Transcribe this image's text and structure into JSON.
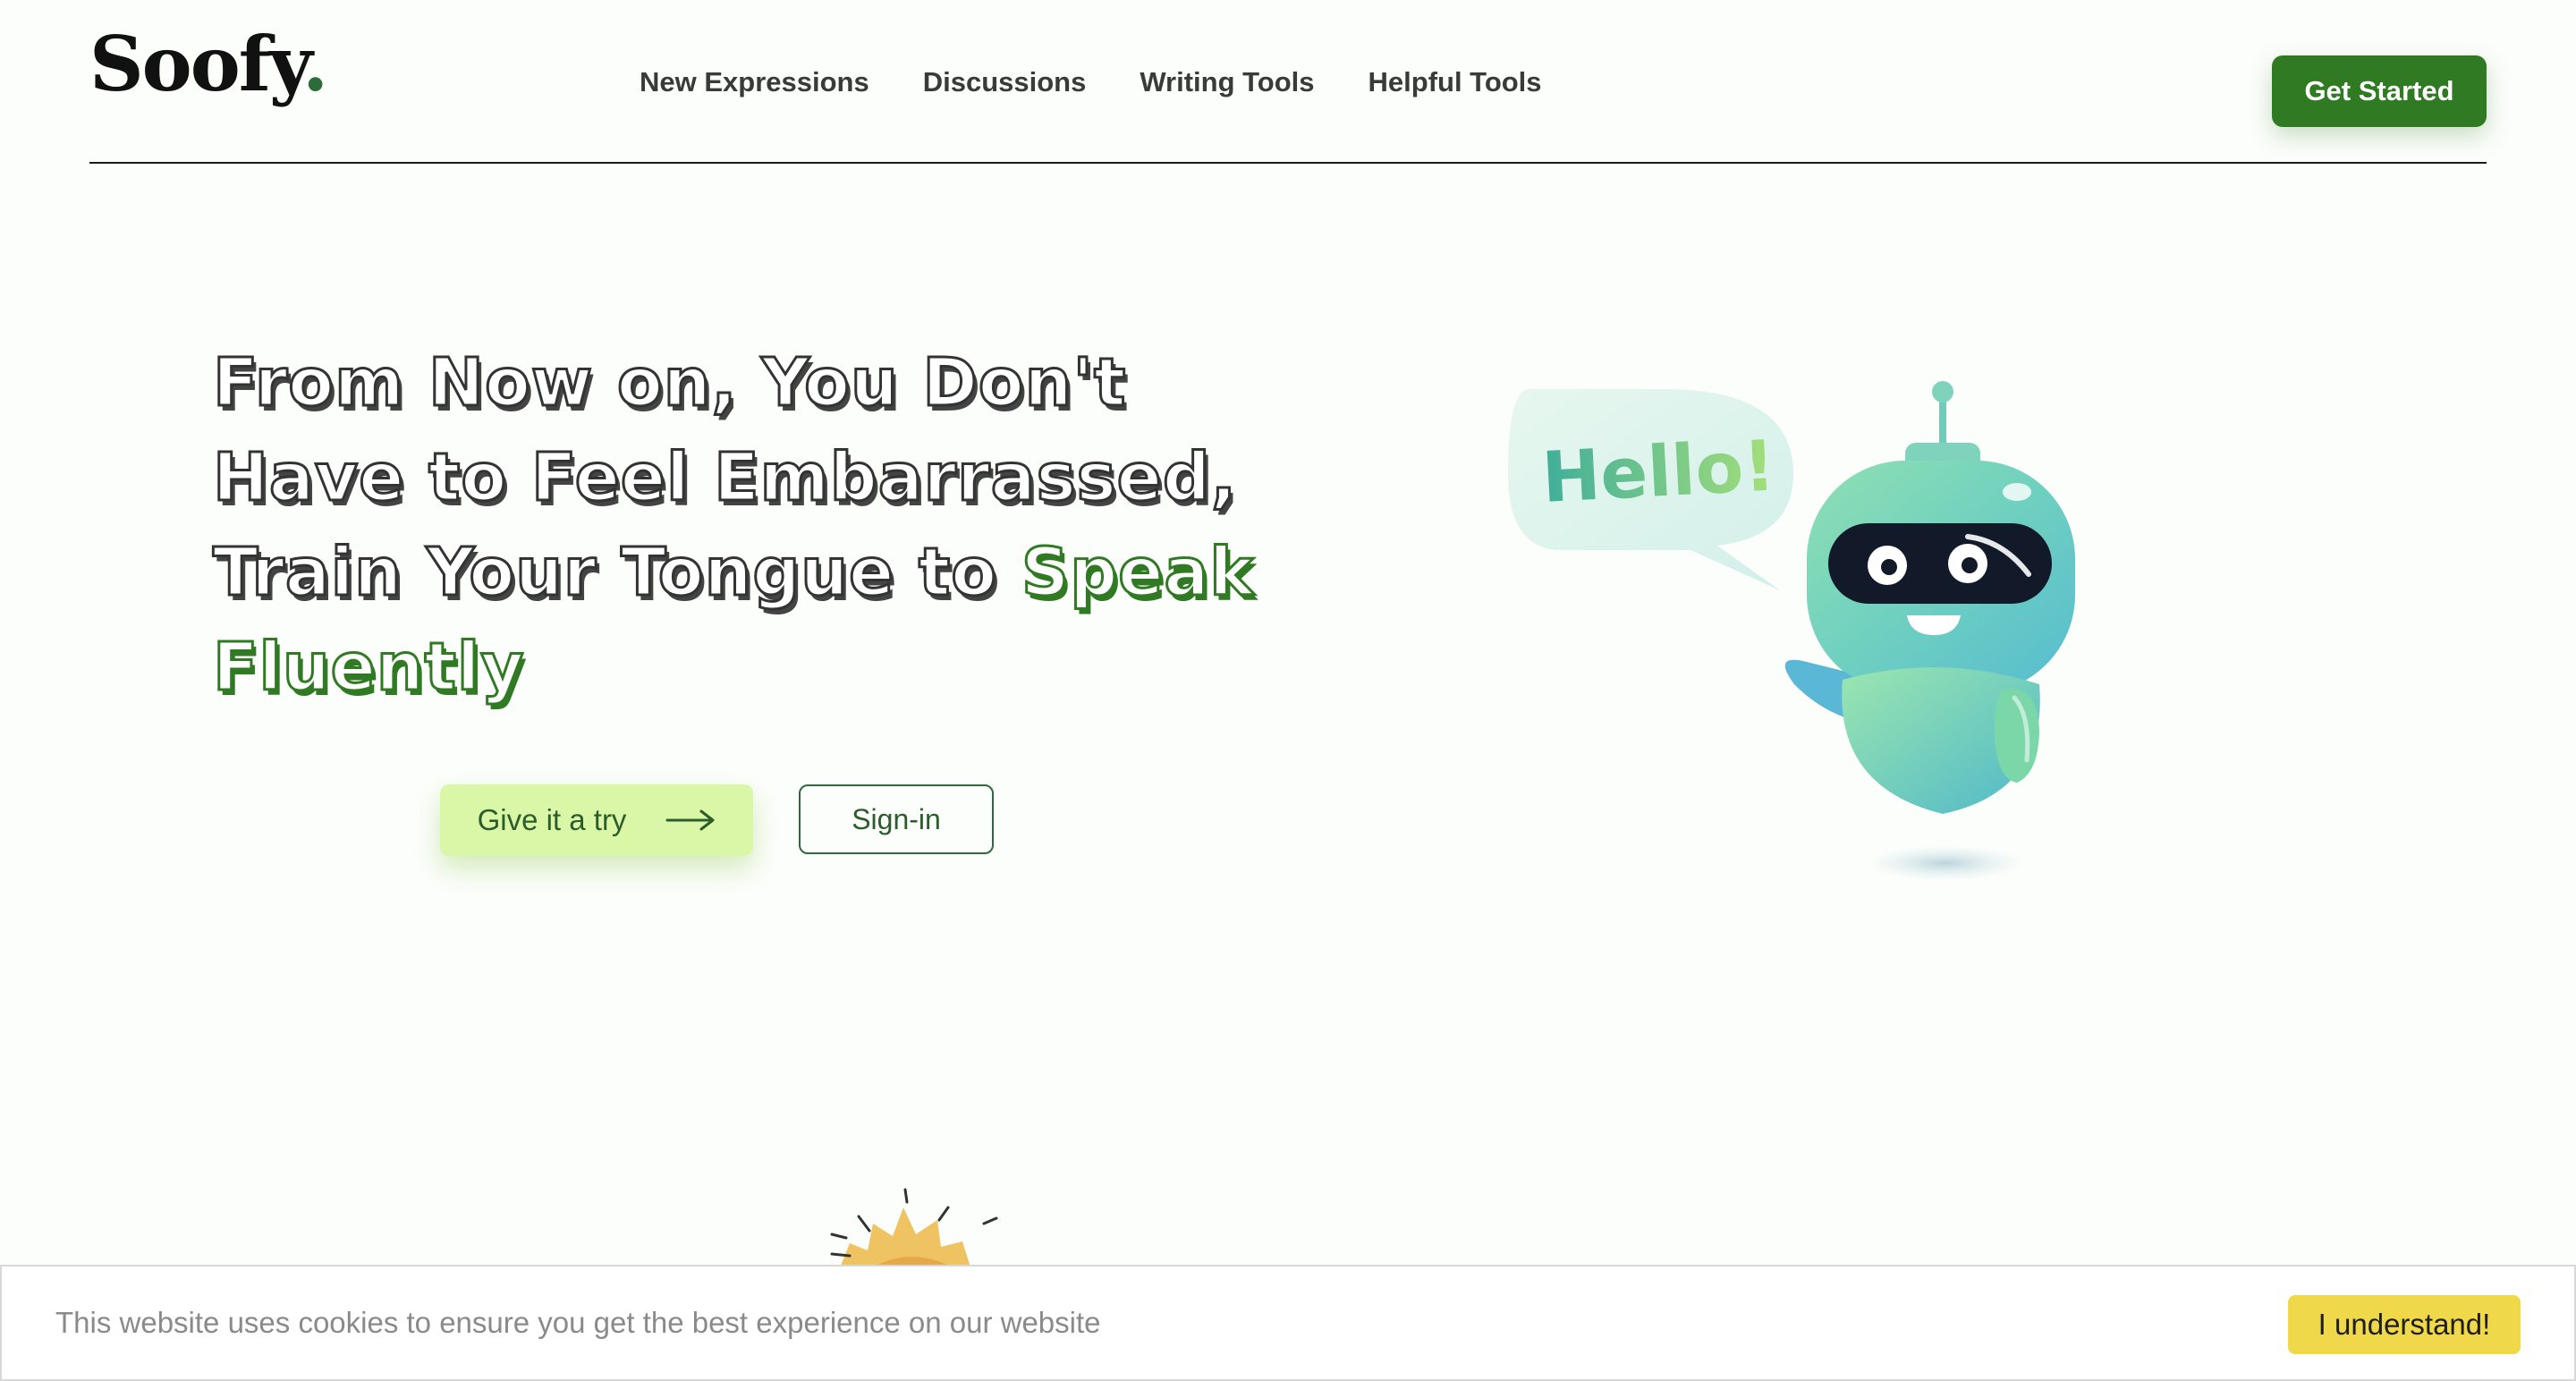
{
  "header": {
    "brand_name": "Soofy",
    "brand_dot": ".",
    "nav": [
      "New Expressions",
      "Discussions",
      "Writing Tools",
      "Helpful Tools"
    ],
    "cta_label": "Get Started"
  },
  "hero": {
    "title_lines": [
      "From Now on, You Don't",
      "Have to Feel Embarrassed,",
      "Train Your Tongue to "
    ],
    "title_highlight_1": "Speak",
    "title_highlight_2": "Fluently",
    "try_label": "Give it a try",
    "signin_label": "Sign-in",
    "speech_bubble_text": "Hello!"
  },
  "cookie": {
    "message": "This website uses cookies to ensure you get the best experience on our website",
    "accept_label": "I understand!"
  },
  "colors": {
    "brand_green": "#2f7a23",
    "try_bg": "#d9f7a6",
    "cookie_button": "#efd84a"
  },
  "icons": [
    "arrow-right-icon",
    "robot-illustration",
    "speech-bubble",
    "sun-illustration"
  ]
}
